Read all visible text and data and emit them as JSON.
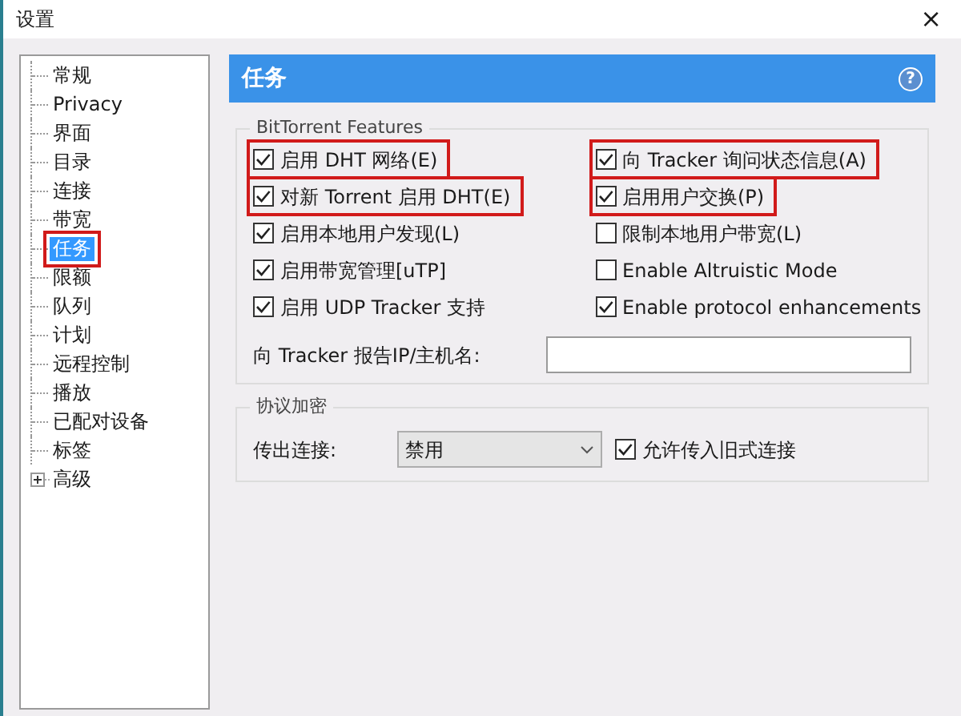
{
  "window": {
    "title": "设置",
    "close": "×"
  },
  "sidebar": {
    "items": [
      {
        "label": "常规",
        "selected": false,
        "highlighted": false,
        "kind": "leaf"
      },
      {
        "label": "Privacy",
        "selected": false,
        "highlighted": false,
        "kind": "leaf"
      },
      {
        "label": "界面",
        "selected": false,
        "highlighted": false,
        "kind": "leaf"
      },
      {
        "label": "目录",
        "selected": false,
        "highlighted": false,
        "kind": "leaf"
      },
      {
        "label": "连接",
        "selected": false,
        "highlighted": false,
        "kind": "leaf"
      },
      {
        "label": "带宽",
        "selected": false,
        "highlighted": false,
        "kind": "leaf"
      },
      {
        "label": "任务",
        "selected": true,
        "highlighted": true,
        "kind": "leaf"
      },
      {
        "label": "限额",
        "selected": false,
        "highlighted": false,
        "kind": "leaf"
      },
      {
        "label": "队列",
        "selected": false,
        "highlighted": false,
        "kind": "leaf"
      },
      {
        "label": "计划",
        "selected": false,
        "highlighted": false,
        "kind": "leaf"
      },
      {
        "label": "远程控制",
        "selected": false,
        "highlighted": false,
        "kind": "leaf"
      },
      {
        "label": "播放",
        "selected": false,
        "highlighted": false,
        "kind": "leaf"
      },
      {
        "label": "已配对设备",
        "selected": false,
        "highlighted": false,
        "kind": "leaf"
      },
      {
        "label": "标签",
        "selected": false,
        "highlighted": false,
        "kind": "leaf"
      },
      {
        "label": "高级",
        "selected": false,
        "highlighted": false,
        "kind": "collapsed"
      }
    ]
  },
  "panel": {
    "title": "任务",
    "help": "?"
  },
  "bittorrent_features": {
    "title": "BitTorrent Features",
    "options": [
      {
        "label": "启用 DHT 网络(E)",
        "checked": true,
        "highlighted": true
      },
      {
        "label": "向 Tracker 询问状态信息(A)",
        "checked": true,
        "highlighted": true
      },
      {
        "label": "对新 Torrent 启用 DHT(E)",
        "checked": true,
        "highlighted": true
      },
      {
        "label": "启用用户交换(P)",
        "checked": true,
        "highlighted": true
      },
      {
        "label": "启用本地用户发现(L)",
        "checked": true,
        "highlighted": false
      },
      {
        "label": "限制本地用户带宽(L)",
        "checked": false,
        "highlighted": false
      },
      {
        "label": "启用带宽管理[uTP]",
        "checked": true,
        "highlighted": false
      },
      {
        "label": "Enable Altruistic Mode",
        "checked": false,
        "highlighted": false
      },
      {
        "label": "启用 UDP Tracker 支持",
        "checked": true,
        "highlighted": false
      },
      {
        "label": "Enable protocol enhancements",
        "checked": true,
        "highlighted": false
      }
    ],
    "report_label": "向 Tracker 报告IP/主机名:"
  },
  "encryption": {
    "title": "协议加密",
    "outgoing_label": "传出连接:",
    "outgoing_value": "禁用",
    "allow_legacy": {
      "label": "允许传入旧式连接",
      "checked": true
    }
  }
}
